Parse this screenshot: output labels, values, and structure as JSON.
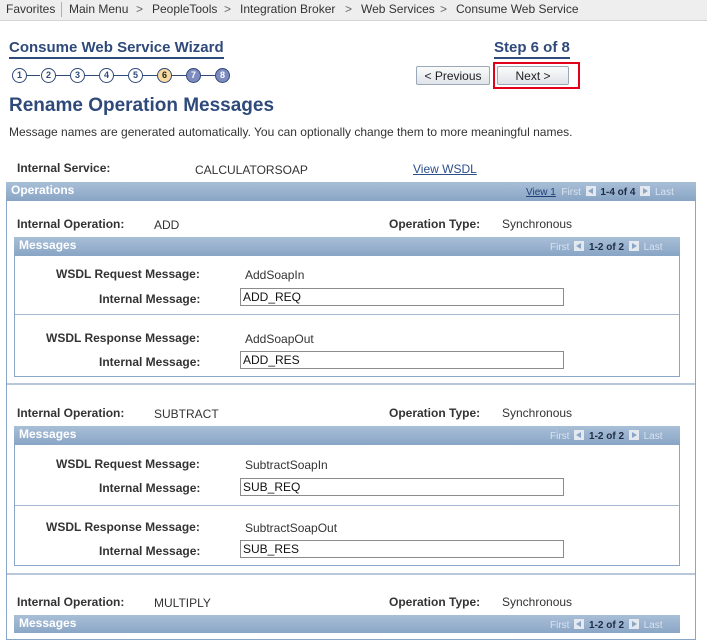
{
  "breadcrumb": {
    "items": [
      "Favorites",
      "Main Menu",
      "PeopleTools",
      "Integration Broker",
      "Web Services",
      "Consume Web Service"
    ]
  },
  "wizard": {
    "title": "Consume Web Service Wizard",
    "step_title": "Step 6 of 8",
    "steps": [
      "1",
      "2",
      "3",
      "4",
      "5",
      "6",
      "7",
      "8"
    ],
    "current_step": 6,
    "previous_label": "< Previous",
    "next_label": "Next >"
  },
  "page": {
    "heading": "Rename Operation Messages",
    "instructions": "Message names are generated automatically. You can optionally change them to more meaningful names.",
    "internal_service_label": "Internal Service:",
    "internal_service_value": "CALCULATORSOAP",
    "view_wsdl_link": "View WSDL"
  },
  "operations_grid": {
    "title": "Operations",
    "view_link": "View 1",
    "first": "First",
    "range": "1-4 of 4",
    "last": "Last"
  },
  "labels": {
    "internal_operation": "Internal Operation:",
    "operation_type": "Operation Type:",
    "messages": "Messages",
    "wsdl_request": "WSDL Request Message:",
    "wsdl_response": "WSDL Response Message:",
    "internal_message": "Internal Message:"
  },
  "operations": [
    {
      "name": "ADD",
      "type": "Synchronous",
      "messages_nav": {
        "first": "First",
        "range": "1-2 of 2",
        "last": "Last"
      },
      "request": {
        "wsdl": "AddSoapIn",
        "internal": "ADD_REQ"
      },
      "response": {
        "wsdl": "AddSoapOut",
        "internal": "ADD_RES"
      }
    },
    {
      "name": "SUBTRACT",
      "type": "Synchronous",
      "messages_nav": {
        "first": "First",
        "range": "1-2 of 2",
        "last": "Last"
      },
      "request": {
        "wsdl": "SubtractSoapIn",
        "internal": "SUB_REQ"
      },
      "response": {
        "wsdl": "SubtractSoapOut",
        "internal": "SUB_RES"
      }
    },
    {
      "name": "MULTIPLY",
      "type": "Synchronous",
      "messages_nav": {
        "first": "First",
        "range": "1-2 of 2",
        "last": "Last"
      }
    }
  ],
  "colors": {
    "accent": "#2f4a7a",
    "grid_header": "#8aa6c6",
    "highlight": "#e2001a"
  }
}
